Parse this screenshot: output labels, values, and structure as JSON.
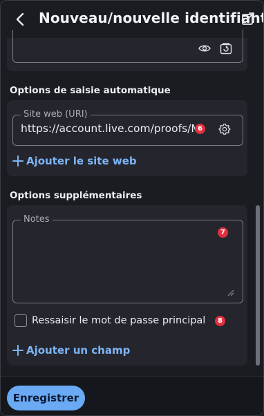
{
  "header": {
    "title": "Nouveau/nouvelle identifiant",
    "back_icon": "chevron-left-icon",
    "popout_icon": "popout-icon"
  },
  "autofill": {
    "heading": "Options de saisie automatique",
    "website_legend": "Site web (URI)",
    "website_value": "https://account.live.com/proofs/Mana",
    "website_badge": "6",
    "add_website_label": "Ajouter le site web"
  },
  "additional": {
    "heading": "Options supplémentaires",
    "notes_legend": "Notes",
    "notes_value": "",
    "notes_badge": "7",
    "reprompt_label": "Ressaisir le mot de passe principal",
    "reprompt_checked": false,
    "reprompt_badge": "8",
    "add_field_label": "Ajouter un champ"
  },
  "footer": {
    "save_label": "Enregistrer"
  },
  "colors": {
    "background": "#1b1c22",
    "card": "#25262d",
    "accent": "#6aa9f4",
    "link": "#7db4f5",
    "badge": "#e0303e"
  }
}
